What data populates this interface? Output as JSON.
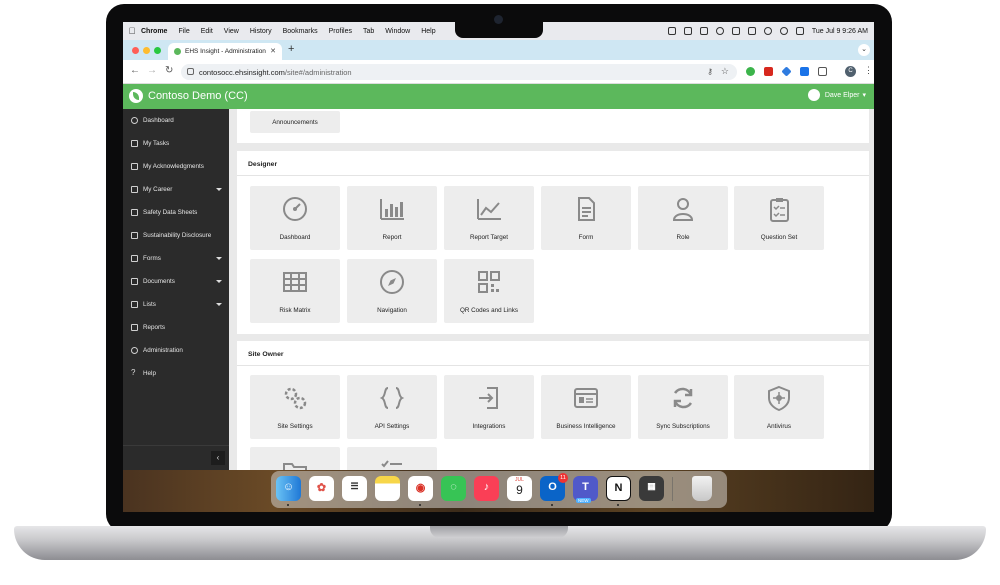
{
  "menubar": {
    "app": "Chrome",
    "items": [
      "File",
      "Edit",
      "View",
      "History",
      "Bookmarks",
      "Profiles",
      "Tab",
      "Window",
      "Help"
    ],
    "clock": "Tue Jul 9  9:26 AM"
  },
  "browser": {
    "tab_title": "EHS Insight - Administration",
    "url_host": "contosocc.ehsinsight.com",
    "url_path": "/site#/administration",
    "profile_initial": "C"
  },
  "app": {
    "title": "Contoso Demo (CC)",
    "user_name": "Dave Elper",
    "brand_color": "#5cb85c"
  },
  "sidebar": {
    "items": [
      {
        "label": "Dashboard",
        "icon": "dashboard-icon"
      },
      {
        "label": "My Tasks",
        "icon": "check-square-icon"
      },
      {
        "label": "My Acknowledgments",
        "icon": "handshake-icon"
      },
      {
        "label": "My Career",
        "icon": "graduation-cap-icon",
        "expandable": true
      },
      {
        "label": "Safety Data Sheets",
        "icon": "truck-icon"
      },
      {
        "label": "Sustainability Disclosure",
        "icon": "bank-icon"
      },
      {
        "label": "Forms",
        "icon": "folder-icon",
        "expandable": true
      },
      {
        "label": "Documents",
        "icon": "folder-icon",
        "expandable": true
      },
      {
        "label": "Lists",
        "icon": "list-icon",
        "expandable": true
      },
      {
        "label": "Reports",
        "icon": "chart-icon"
      },
      {
        "label": "Administration",
        "icon": "gear-icon"
      },
      {
        "label": "Help",
        "icon": "question-icon"
      }
    ]
  },
  "sections": {
    "top_tile": "Announcements",
    "designer": {
      "title": "Designer",
      "tiles": [
        "Dashboard",
        "Report",
        "Report Target",
        "Form",
        "Role",
        "Question Set",
        "Risk Matrix",
        "Navigation",
        "QR Codes and Links"
      ]
    },
    "site_owner": {
      "title": "Site Owner",
      "tiles": [
        "Site Settings",
        "API Settings",
        "Integrations",
        "Business Intelligence",
        "Sync Subscriptions",
        "Antivirus"
      ]
    }
  },
  "dock": {
    "calendar_month": "JUL",
    "calendar_day": "9",
    "outlook_badge": "11",
    "teams_badge": "NEW"
  }
}
